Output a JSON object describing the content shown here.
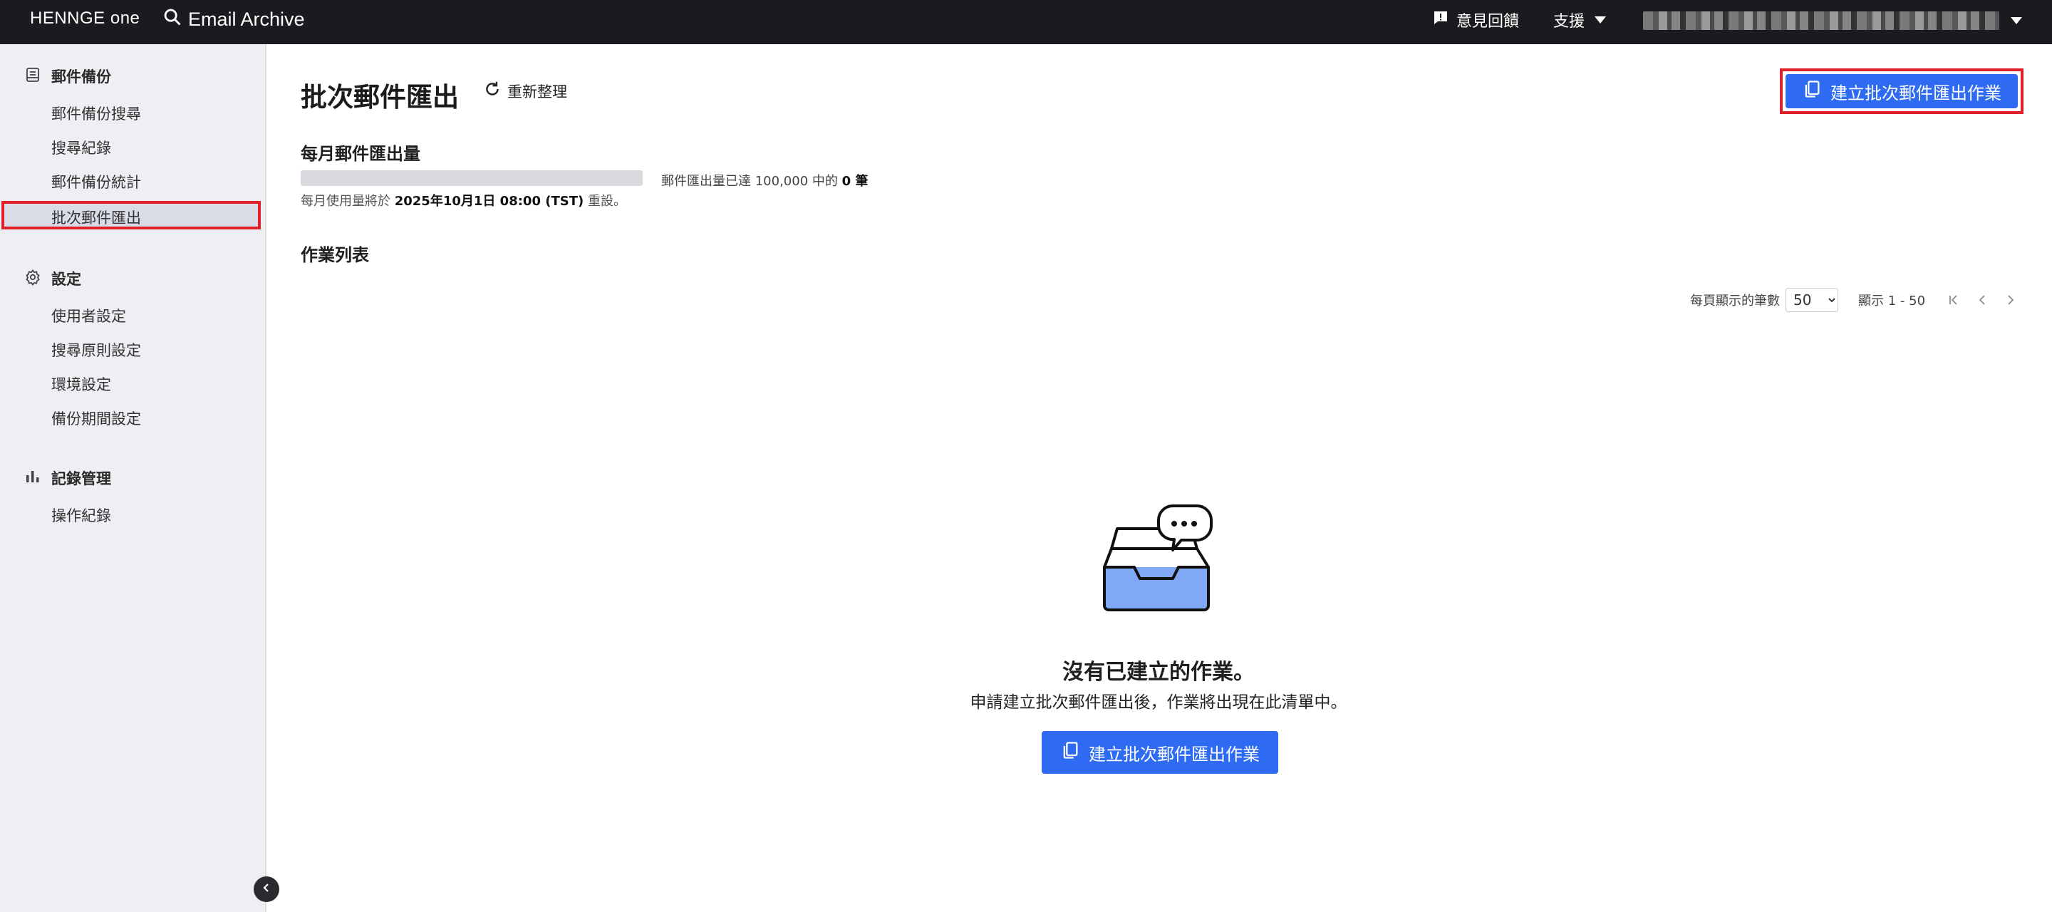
{
  "topbar": {
    "brand_main": "HENNGE ",
    "brand_one": "one",
    "app_name": "Email Archive",
    "feedback_label": "意見回饋",
    "support_label": "支援"
  },
  "sidebar": {
    "groups": [
      {
        "title": "郵件備份",
        "items": [
          "郵件備份搜尋",
          "搜尋紀錄",
          "郵件備份統計",
          "批次郵件匯出"
        ]
      },
      {
        "title": "設定",
        "items": [
          "使用者設定",
          "搜尋原則設定",
          "環境設定",
          "備份期間設定"
        ]
      },
      {
        "title": "記錄管理",
        "items": [
          "操作紀錄"
        ]
      }
    ],
    "active_item": "批次郵件匯出"
  },
  "main": {
    "title": "批次郵件匯出",
    "refresh_label": "重新整理",
    "create_button_label": "建立批次郵件匯出作業",
    "usage": {
      "section_title": "每月郵件匯出量",
      "used": 0,
      "limit": 100000,
      "text_prefix": "郵件匯出量已達 100,000 中的 ",
      "text_count": "0 筆",
      "reset_prefix": "每月使用量將於 ",
      "reset_date": "2025年10月1日 08:00 (TST)",
      "reset_suffix": " 重設。"
    },
    "jobs": {
      "section_title": "作業列表",
      "per_page_label": "每頁顯示的筆數",
      "per_page_value": "50",
      "range_label": "顯示 1 - 50"
    },
    "empty": {
      "title": "沒有已建立的作業。",
      "subtitle": "申請建立批次郵件匯出後，作業將出現在此清單中。",
      "button_label": "建立批次郵件匯出作業"
    }
  },
  "colors": {
    "topbar_bg": "#1b1b1f",
    "sidebar_bg": "#eeeff3",
    "primary": "#2e6bf2",
    "highlight_outline": "#e0202b"
  }
}
